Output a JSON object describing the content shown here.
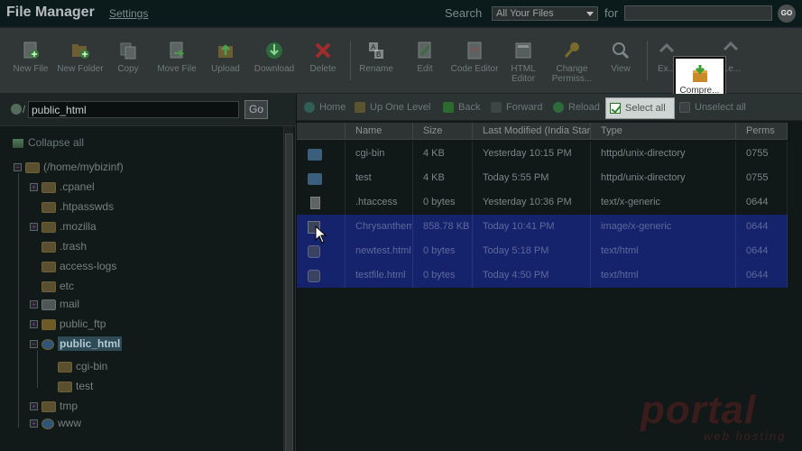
{
  "header": {
    "app_title": "File Manager",
    "settings_link": "Settings",
    "search_label": "Search",
    "search_scope": "All Your Files",
    "for_label": "for",
    "search_value": "",
    "go_label": "GO"
  },
  "toolbar": {
    "buttons": [
      {
        "label": "New File",
        "icon": "new-file-icon"
      },
      {
        "label": "New Folder",
        "icon": "new-folder-icon"
      },
      {
        "label": "Copy",
        "icon": "copy-icon"
      },
      {
        "label": "Move File",
        "icon": "move-file-icon"
      },
      {
        "label": "Upload",
        "icon": "upload-icon"
      },
      {
        "label": "Download",
        "icon": "download-icon"
      },
      {
        "label": "Delete",
        "icon": "delete-icon"
      },
      {
        "label": "Rename",
        "icon": "rename-icon"
      },
      {
        "label": "Edit",
        "icon": "edit-icon"
      },
      {
        "label": "Code Editor",
        "icon": "code-editor-icon"
      },
      {
        "label": "HTML Editor",
        "icon": "html-editor-icon"
      },
      {
        "label": "Change Permiss...",
        "icon": "permissions-icon"
      },
      {
        "label": "View",
        "icon": "view-icon"
      },
      {
        "label": "Ex...",
        "icon": "extract-icon"
      },
      {
        "label": "...e...",
        "icon": "compress-icon"
      }
    ],
    "compress_popup": "Compre..."
  },
  "left": {
    "path_value": "public_html",
    "path_slash": "/",
    "go_label": "Go",
    "collapse_all": "Collapse all",
    "tree": [
      {
        "label": "(/home/mybizinf)"
      },
      {
        "label": ".cpanel"
      },
      {
        "label": ".htpasswds"
      },
      {
        "label": ".mozilla"
      },
      {
        "label": ".trash"
      },
      {
        "label": "access-logs"
      },
      {
        "label": "etc"
      },
      {
        "label": "mail"
      },
      {
        "label": "public_ftp"
      },
      {
        "label": "public_html"
      },
      {
        "label": "cgi-bin"
      },
      {
        "label": "test"
      },
      {
        "label": "tmp"
      },
      {
        "label": "www"
      }
    ]
  },
  "nav": {
    "home": "Home",
    "up": "Up One Level",
    "back": "Back",
    "forward": "Forward",
    "reload": "Reload",
    "select_all": "Select all",
    "unselect_all": "Unselect all"
  },
  "table": {
    "columns": [
      "Name",
      "Size",
      "Last Modified (India Standard)",
      "Type",
      "Perms"
    ],
    "rows": [
      {
        "name": "cgi-bin",
        "size": "4 KB",
        "modified": "Yesterday 10:15 PM",
        "type": "httpd/unix-directory",
        "perms": "0755",
        "icon": "folder-icon"
      },
      {
        "name": "test",
        "size": "4 KB",
        "modified": "Today 5:55 PM",
        "type": "httpd/unix-directory",
        "perms": "0755",
        "icon": "folder-icon"
      },
      {
        "name": ".htaccess",
        "size": "0 bytes",
        "modified": "Yesterday 10:36 PM",
        "type": "text/x-generic",
        "perms": "0644",
        "icon": "file-icon"
      },
      {
        "name": "Chrysanthem",
        "size": "858.78 KB",
        "modified": "Today 10:41 PM",
        "type": "image/x-generic",
        "perms": "0644",
        "icon": "image-icon"
      },
      {
        "name": "newtest.html",
        "size": "0 bytes",
        "modified": "Today 5:18 PM",
        "type": "text/html",
        "perms": "0644",
        "icon": "html-file-icon"
      },
      {
        "name": "testfile.html",
        "size": "0 bytes",
        "modified": "Today 4:50 PM",
        "type": "text/html",
        "perms": "0644",
        "icon": "html-file-icon"
      }
    ]
  },
  "watermark": {
    "brand": "portal",
    "sub": "web hosting"
  },
  "colors": {
    "selection": "#15226c",
    "header_bg": "#0b1a1b",
    "toolbar_bg": "#303736"
  }
}
